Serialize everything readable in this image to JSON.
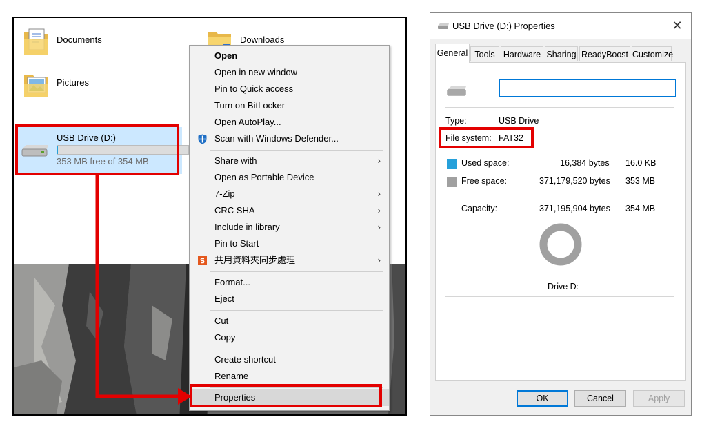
{
  "explorer": {
    "folders": [
      {
        "label": "Documents",
        "icon": "documents-folder-icon"
      },
      {
        "label": "Downloads",
        "icon": "downloads-folder-icon"
      },
      {
        "label": "Pictures",
        "icon": "pictures-folder-icon"
      }
    ],
    "drive": {
      "name": "USB Drive (D:)",
      "free_text": "353 MB free of 354 MB",
      "used_fraction": 0.0003,
      "icon": "usb-drive-icon"
    }
  },
  "context_menu": {
    "items": [
      {
        "label": "Open",
        "bold": true
      },
      {
        "label": "Open in new window"
      },
      {
        "label": "Pin to Quick access"
      },
      {
        "label": "Turn on BitLocker"
      },
      {
        "label": "Open AutoPlay..."
      },
      {
        "label": "Scan with Windows Defender...",
        "icon": "windows-defender-icon"
      },
      {
        "label": "Share with",
        "submenu": true
      },
      {
        "label": "Open as Portable Device"
      },
      {
        "label": "7-Zip",
        "submenu": true
      },
      {
        "label": "CRC SHA",
        "submenu": true
      },
      {
        "label": "Include in library",
        "submenu": true
      },
      {
        "label": "Pin to Start"
      },
      {
        "label": "共用資料夾同步處理",
        "icon": "sync-folder-icon",
        "submenu": true
      },
      {
        "label": "Format..."
      },
      {
        "label": "Eject"
      },
      {
        "label": "Cut"
      },
      {
        "label": "Copy"
      },
      {
        "label": "Create shortcut"
      },
      {
        "label": "Rename"
      },
      {
        "label": "Properties"
      }
    ],
    "submenu_glyph": "›"
  },
  "dialog": {
    "title": "USB Drive (D:) Properties",
    "close_glyph": "✕",
    "tabs": [
      "General",
      "Tools",
      "Hardware",
      "Sharing",
      "ReadyBoost",
      "Customize"
    ],
    "active_tab": "General",
    "label_value": "",
    "type_label": "Type:",
    "type_value": "USB Drive",
    "fs_label": "File system:",
    "fs_value": "FAT32",
    "used_label": "Used space:",
    "used_bytes": "16,384 bytes",
    "used_size": "16.0 KB",
    "free_label": "Free space:",
    "free_bytes": "371,179,520 bytes",
    "free_size": "353 MB",
    "capacity_label": "Capacity:",
    "capacity_bytes": "371,195,904 bytes",
    "capacity_size": "354 MB",
    "drive_caption": "Drive D:",
    "buttons": {
      "ok": "OK",
      "cancel": "Cancel",
      "apply": "Apply"
    }
  },
  "colors": {
    "highlight_red": "#e30000",
    "used_color": "#26a0da",
    "free_color": "#a0a0a0",
    "selection_blue": "#cce8ff"
  }
}
